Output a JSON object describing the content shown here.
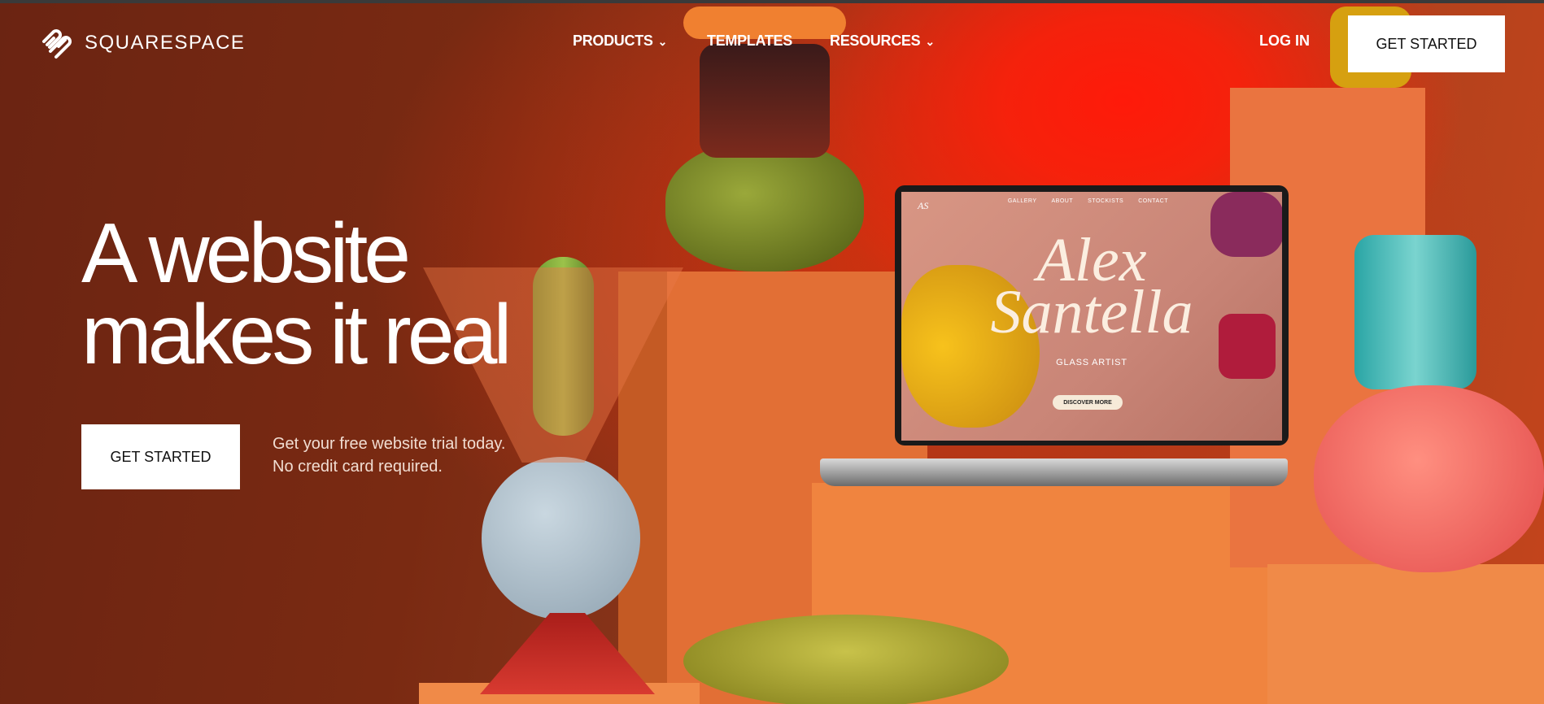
{
  "header": {
    "logo_text": "SQUARESPACE",
    "logo_icon": "squarespace-logo-icon",
    "nav": [
      {
        "label": "PRODUCTS",
        "has_dropdown": true
      },
      {
        "label": "TEMPLATES",
        "has_dropdown": false
      },
      {
        "label": "RESOURCES",
        "has_dropdown": true
      }
    ],
    "login_label": "LOG IN",
    "get_started_label": "GET STARTED"
  },
  "hero": {
    "headline_line1": "A website",
    "headline_line2": "makes it real",
    "cta_label": "GET STARTED",
    "sub_line1": "Get your free website trial today.",
    "sub_line2": "No credit card required."
  },
  "laptop_site": {
    "monogram": "AS",
    "nav": [
      "GALLERY",
      "ABOUT",
      "STOCKISTS",
      "CONTACT"
    ],
    "name_line1": "Alex",
    "name_line2": "Santella",
    "role": "GLASS ARTIST",
    "button": "DISCOVER MORE"
  },
  "colors": {
    "background_dark": "#6b2412",
    "accent_red": "#ff1a0a",
    "pedestal_orange": "#ec7a3e",
    "button_bg": "#ffffff",
    "text_light": "#ffffff"
  },
  "icons": {
    "dropdown": "chevron-down-icon"
  }
}
